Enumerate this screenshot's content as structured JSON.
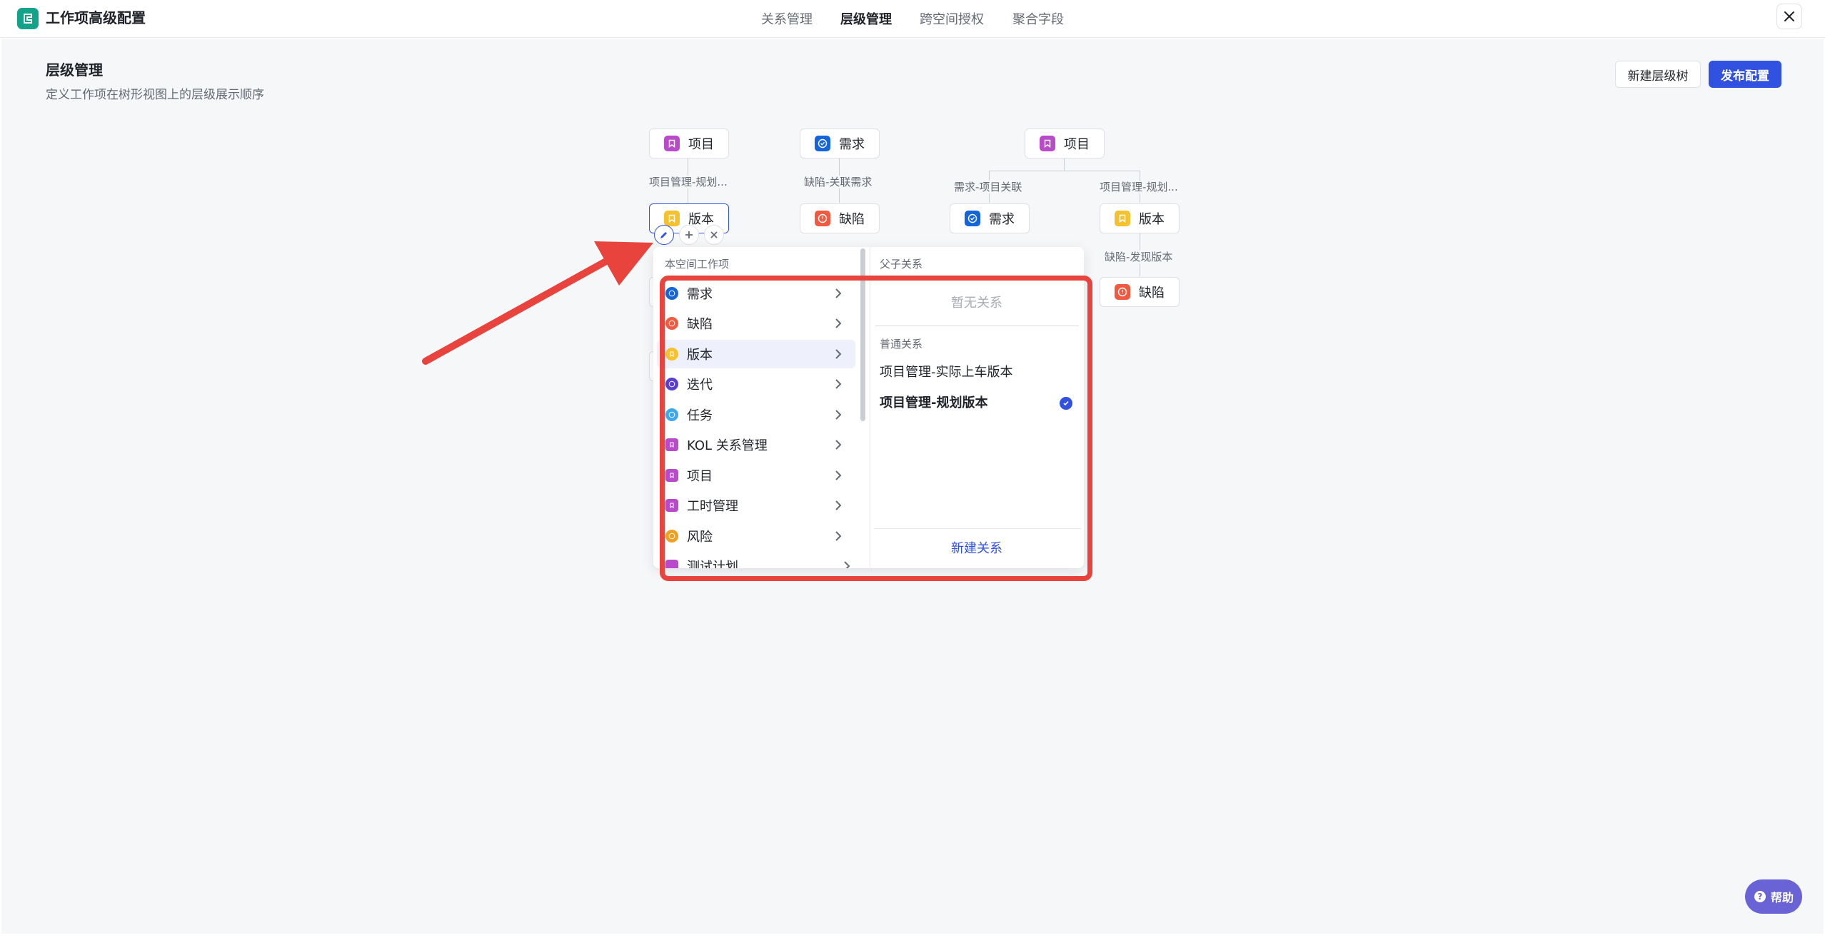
{
  "app": {
    "title": "工作项高级配置"
  },
  "tabs": [
    {
      "label": "关系管理"
    },
    {
      "label": "层级管理"
    },
    {
      "label": "跨空间授权"
    },
    {
      "label": "聚合字段"
    }
  ],
  "page": {
    "title": "层级管理",
    "description": "定义工作项在树形视图上的层级展示顺序",
    "new_tree_label": "新建层级树",
    "publish_label": "发布配置"
  },
  "trees": [
    {
      "root": "项目",
      "edge": "项目管理-规划...",
      "child": "版本"
    },
    {
      "root": "需求",
      "edge": "缺陷-关联需求",
      "child": "缺陷"
    },
    {
      "root": "项目",
      "children": [
        {
          "edge": "需求-项目关联",
          "label": "需求"
        },
        {
          "edge": "项目管理-规划...",
          "label": "版本",
          "sub_edge": "缺陷-发现版本",
          "sub_child": "缺陷"
        }
      ]
    }
  ],
  "dropdown": {
    "left_title": "本空间工作项",
    "right_title": "父子关系",
    "items": [
      {
        "label": "需求",
        "color": "#1664d9",
        "icon": "check-circle-icon"
      },
      {
        "label": "缺陷",
        "color": "#f05a40",
        "icon": "alert-circle-icon"
      },
      {
        "label": "版本",
        "color": "#f5c12e",
        "icon": "bookmark-icon"
      },
      {
        "label": "迭代",
        "color": "#5a3ed0",
        "icon": "loop-icon"
      },
      {
        "label": "任务",
        "color": "#3da9ec",
        "icon": "task-icon"
      },
      {
        "label": "KOL 关系管理",
        "color": "#b94ac9",
        "icon": "bookmark-icon"
      },
      {
        "label": "项目",
        "color": "#b94ac9",
        "icon": "bookmark-icon"
      },
      {
        "label": "工时管理",
        "color": "#b94ac9",
        "icon": "bookmark-icon"
      },
      {
        "label": "风险",
        "color": "#f0a020",
        "icon": "risk-icon"
      },
      {
        "label": "测试计划",
        "color": "#b94ac9",
        "icon": "bookmark-icon"
      }
    ],
    "selected_item": "版本",
    "empty_text": "暂无关系",
    "normal_title": "普通关系",
    "relations": [
      {
        "label": "项目管理-实际上车版本",
        "checked": false
      },
      {
        "label": "项目管理-规划版本",
        "checked": true
      }
    ],
    "new_relation_label": "新建关系"
  },
  "help": {
    "label": "帮助"
  },
  "colors": {
    "accent": "#3151e0",
    "highlight": "#e8433c",
    "project": "#b94ac9",
    "requirement": "#1664d9",
    "defect": "#f05a40",
    "version": "#f5c12e"
  }
}
